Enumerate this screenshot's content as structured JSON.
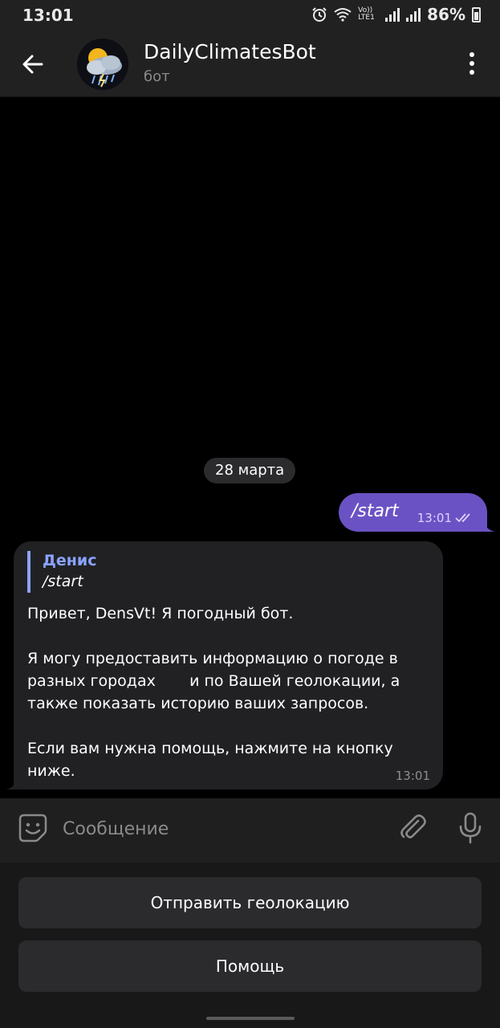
{
  "status_bar": {
    "time": "13:01",
    "network_label": "Vo)) LTE1",
    "battery": "86%"
  },
  "header": {
    "title": "DailyClimatesBot",
    "subtitle": "бот"
  },
  "chat": {
    "date_separator": "28 марта",
    "outgoing": {
      "text": "/start",
      "time": "13:01",
      "status_icon": "double-check-icon"
    },
    "incoming": {
      "reply_author": "Денис",
      "reply_text": "/start",
      "text": "Привет, DensVt! Я погодный бот.\n\nЯ могу предоставить информацию о погоде в разных городах       и по Вашей геолокации, а также показать историю ваших запросов.\n\nЕсли вам нужна помощь, нажмите на кнопку ниже.",
      "time": "13:01"
    }
  },
  "composer": {
    "placeholder": "Сообщение"
  },
  "keyboard": {
    "buttons": [
      {
        "label": "Отправить геолокацию"
      },
      {
        "label": "Помощь"
      }
    ]
  },
  "colors": {
    "accent": "#6b52c4",
    "reply_accent": "#8aa3ff",
    "bubble_incoming": "#212124",
    "panel": "#212121"
  }
}
